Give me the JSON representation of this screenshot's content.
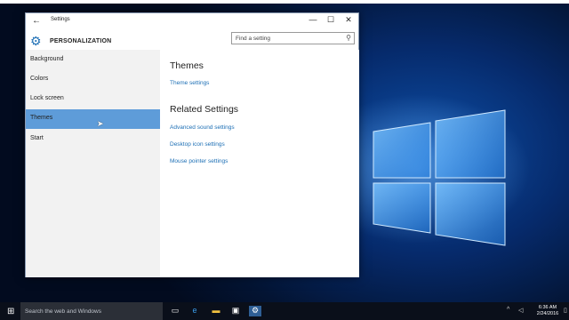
{
  "window": {
    "title": "Settings",
    "section": "PERSONALIZATION",
    "search_placeholder": "Find a setting",
    "controls": {
      "minimize": "—",
      "maximize": "☐",
      "close": "✕"
    }
  },
  "sidebar": {
    "items": [
      {
        "label": "Background"
      },
      {
        "label": "Colors"
      },
      {
        "label": "Lock screen"
      },
      {
        "label": "Themes"
      },
      {
        "label": "Start"
      }
    ],
    "selected": "Themes"
  },
  "content": {
    "heading": "Themes",
    "theme_settings_link": "Theme settings",
    "related_heading": "Related Settings",
    "related_links": [
      "Advanced sound settings",
      "Desktop icon settings",
      "Mouse pointer settings"
    ]
  },
  "taskbar": {
    "search_placeholder": "Search the web and Windows",
    "time": "6:36 AM",
    "date": "2/24/2016"
  },
  "colors": {
    "accent": "#5e9cd9",
    "link": "#1d6fb5",
    "desktop": "#062a6b",
    "taskbar": "#0a0f1a"
  }
}
